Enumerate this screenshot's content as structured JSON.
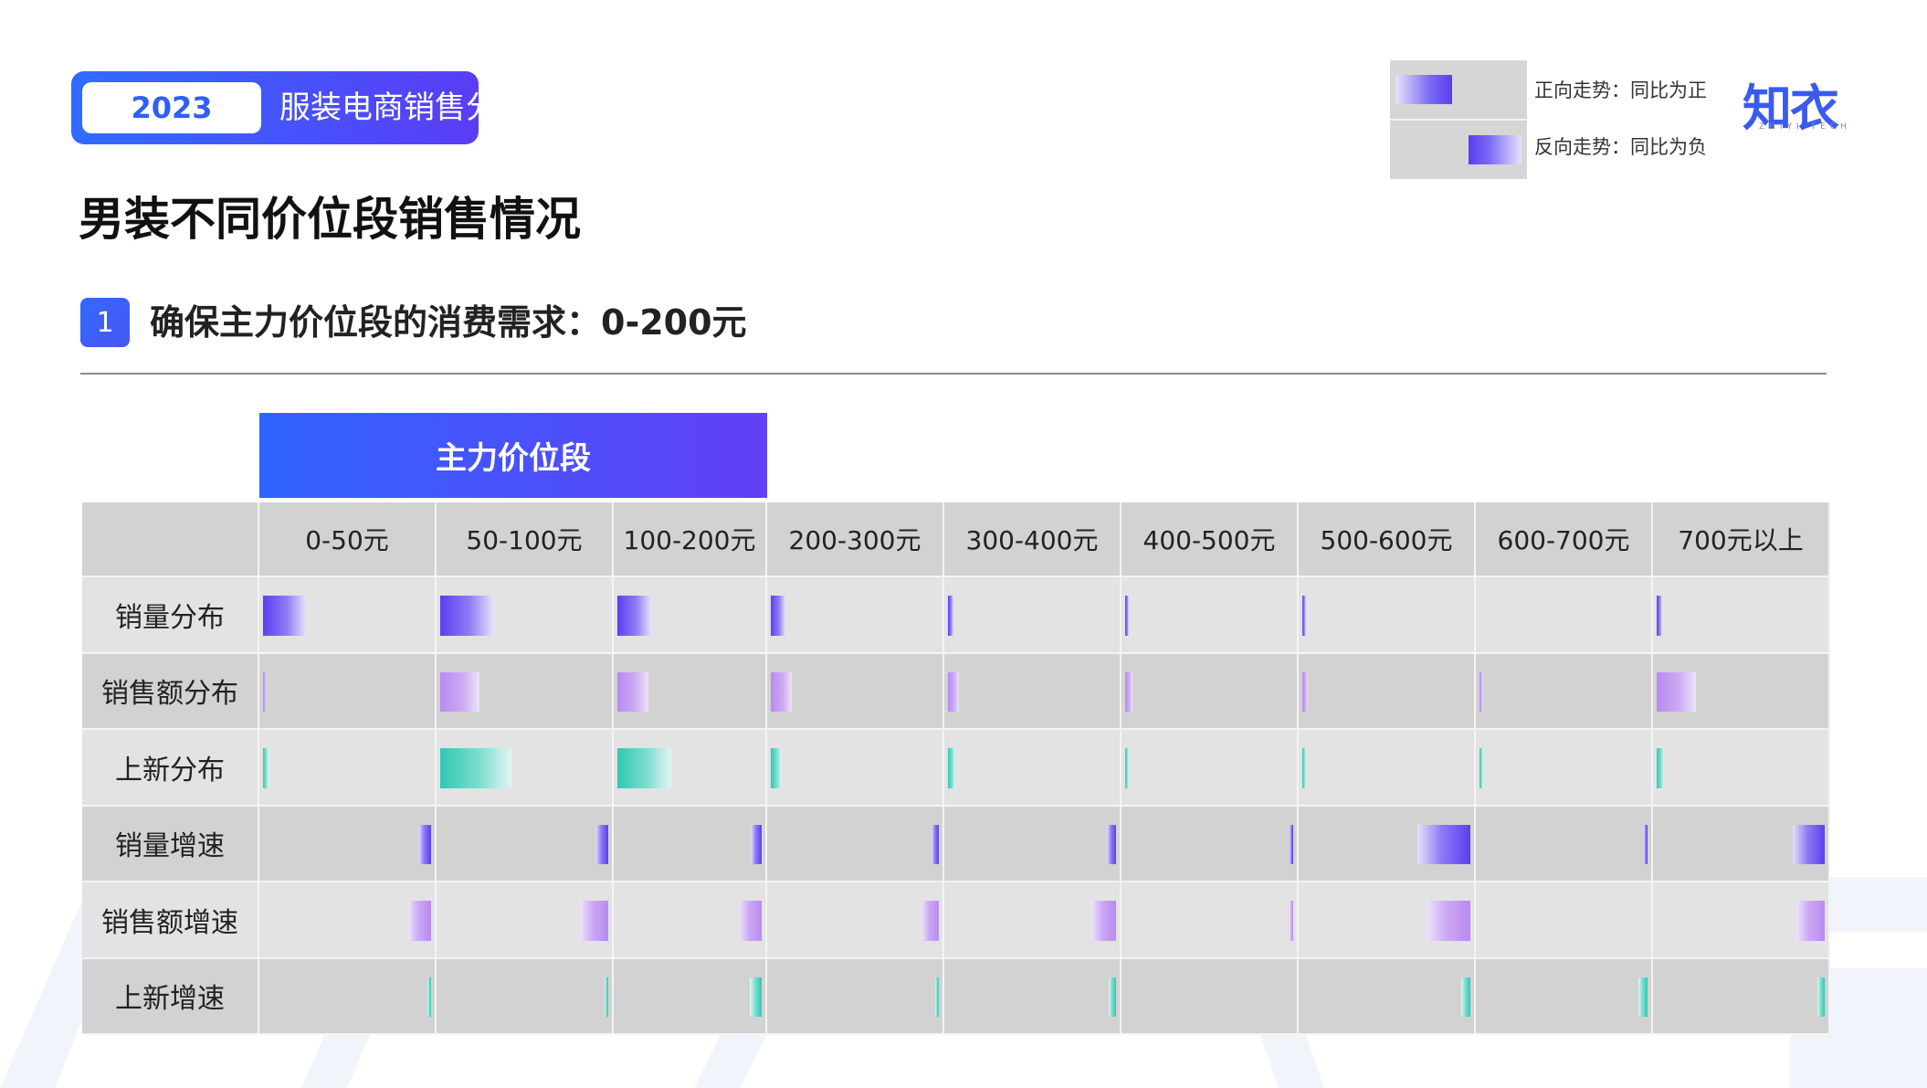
{
  "header": {
    "year": "2023",
    "subtitle": "服装电商销售分析"
  },
  "page_title": "男装不同价位段销售情况",
  "section": {
    "number": "1",
    "text": "确保主力价位段的消费需求：0-200元"
  },
  "legend": {
    "positive_label": "正向走势：同比为正",
    "negative_label": "反向走势：同比为负"
  },
  "logo": {
    "text": "知衣",
    "subtext": "ZHIYI TECH"
  },
  "colors": {
    "accent": "#2f6bff",
    "purple": "#6b4df5",
    "violet": "#b58df0",
    "teal": "#2fc9b4",
    "row_light": "#e3e3e3",
    "row_dark": "#d2d2d2"
  },
  "chart_data": {
    "type": "table",
    "band_label": "主力价位段",
    "band_columns": [
      "0-50元",
      "50-100元",
      "100-200元"
    ],
    "columns": [
      "0-50元",
      "50-100元",
      "100-200元",
      "200-300元",
      "300-400元",
      "400-500元",
      "500-600元",
      "600-700元",
      "700元以上"
    ],
    "rows": [
      {
        "label": "销量分布",
        "style": "purple",
        "direction": "positive",
        "values": [
          0.24,
          0.3,
          0.22,
          0.08,
          0.03,
          0.02,
          0.02,
          0.0,
          0.03
        ]
      },
      {
        "label": "销售额分布",
        "style": "violet",
        "direction": "positive",
        "values": [
          0.02,
          0.22,
          0.2,
          0.12,
          0.06,
          0.04,
          0.03,
          0.02,
          0.22
        ]
      },
      {
        "label": "上新分布",
        "style": "teal",
        "direction": "positive",
        "values": [
          0.03,
          0.4,
          0.35,
          0.06,
          0.04,
          0.02,
          0.01,
          0.01,
          0.04
        ]
      },
      {
        "label": "销量增速",
        "style": "purple",
        "direction": "negative",
        "values": [
          0.07,
          0.07,
          0.07,
          0.04,
          0.05,
          0.02,
          0.3,
          0.01,
          0.18
        ]
      },
      {
        "label": "销售额增速",
        "style": "violet",
        "direction": "negative",
        "values": [
          0.13,
          0.16,
          0.15,
          0.1,
          0.14,
          0.02,
          0.25,
          0.0,
          0.16
        ]
      },
      {
        "label": "上新增速",
        "style": "teal",
        "direction": "negative",
        "values": [
          0.01,
          0.02,
          0.08,
          0.02,
          0.04,
          0.0,
          0.05,
          0.05,
          0.04
        ]
      }
    ]
  }
}
